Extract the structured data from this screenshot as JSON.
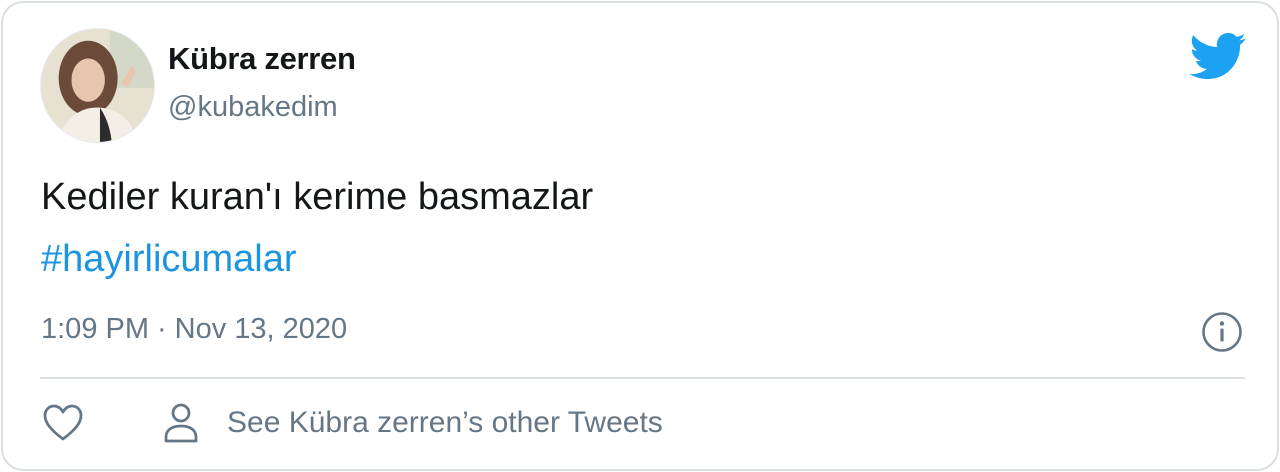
{
  "tweet": {
    "author": {
      "display_name": "Kübra zerren",
      "handle": "@kubakedim",
      "avatar_icon": "user-avatar-photo"
    },
    "text": "Kediler kuran'ı kerime basmazlar",
    "hashtag": "#hayirlicumalar",
    "time": "1:09 PM",
    "separator": "·",
    "date": "Nov 13, 2020"
  },
  "actions": {
    "like_icon": "heart-icon",
    "other_tweets_icon": "person-icon",
    "other_tweets_label": "See Kübra zerren’s other Tweets",
    "info_icon": "info-icon"
  },
  "branding": {
    "logo_icon": "twitter-bird-icon"
  },
  "colors": {
    "accent": "#1da1f2",
    "hashtag": "#1b95e0",
    "text_primary": "#14171a",
    "text_secondary": "#657786",
    "border": "#d9dfe3"
  }
}
